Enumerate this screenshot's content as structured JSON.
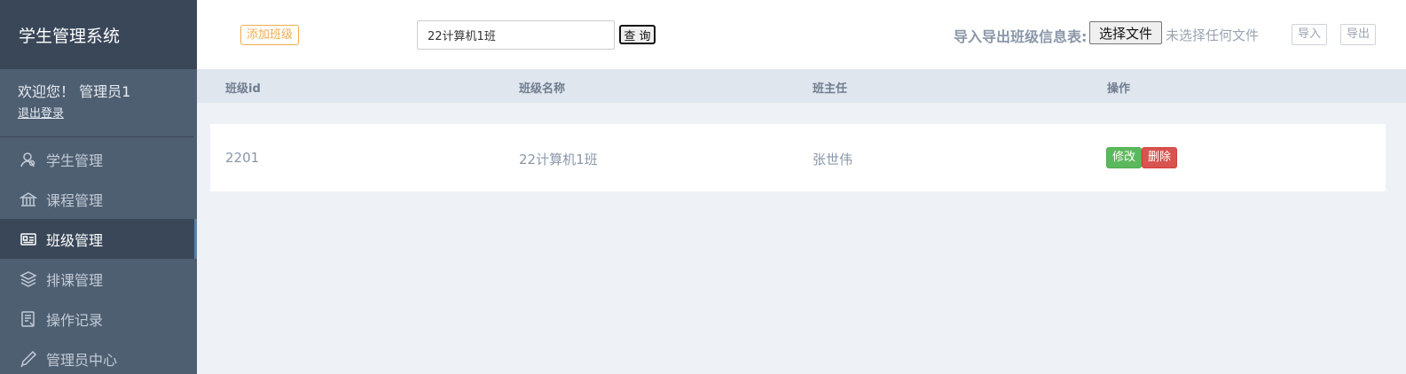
{
  "app": {
    "title": "学生管理系统"
  },
  "user": {
    "welcome": "欢迎您！ 管理员1",
    "logout": "退出登录"
  },
  "sidebar": {
    "items": [
      {
        "label": "学生管理",
        "icon": "user-icon",
        "active": false
      },
      {
        "label": "课程管理",
        "icon": "bank-icon",
        "active": false
      },
      {
        "label": "班级管理",
        "icon": "id-card-icon",
        "active": true
      },
      {
        "label": "排课管理",
        "icon": "layers-icon",
        "active": false
      },
      {
        "label": "操作记录",
        "icon": "document-icon",
        "active": false
      },
      {
        "label": "管理员中心",
        "icon": "pen-icon",
        "active": false
      }
    ]
  },
  "toolbar": {
    "add_label": "添加班级",
    "search_value": "22计算机1班",
    "query_label": "查 询",
    "io_label": "导入导出班级信息表:",
    "file_button": "选择文件",
    "file_status": "未选择任何文件",
    "import_label": "导入",
    "export_label": "导出"
  },
  "table": {
    "headers": [
      "班级id",
      "班级名称",
      "班主任",
      "操作"
    ],
    "rows": [
      {
        "id": "2201",
        "name": "22计算机1班",
        "teacher": "张世伟",
        "edit": "修改",
        "delete": "删除"
      }
    ]
  },
  "colors": {
    "sidebar_bg": "#4f5f72",
    "sidebar_dark": "#3a4759",
    "accent_orange": "#f0ad4e",
    "success": "#5cb85c",
    "danger": "#d9534f"
  }
}
